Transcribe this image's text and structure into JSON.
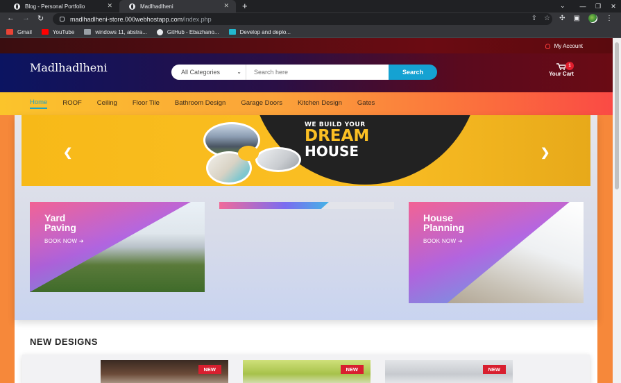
{
  "browser": {
    "tabs": [
      {
        "title": "Blog - Personal Portfolio",
        "active": false
      },
      {
        "title": "Madlhadlheni",
        "active": true
      }
    ],
    "url_host": "madlhadlheni-store.000webhostapp.com",
    "url_path": "/index.php",
    "bookmarks": [
      {
        "label": "Gmail",
        "color": "#ea4335"
      },
      {
        "label": "YouTube",
        "color": "#ff0000"
      },
      {
        "label": "windows 11, abstra...",
        "color": "#9aa0a6"
      },
      {
        "label": "GitHub - Ebazhano...",
        "color": "#e8eaed"
      },
      {
        "label": "Develop and deplo...",
        "color": "#22b8cf"
      }
    ]
  },
  "site": {
    "account_label": "My Account",
    "logo": "Madlhadlheni",
    "search": {
      "category": "All Categories",
      "placeholder": "Search here",
      "button": "Search"
    },
    "cart": {
      "label": "Your Cart",
      "count": "1"
    },
    "nav": [
      "Home",
      "ROOF",
      "Ceiling",
      "Floor Tile",
      "Bathroom Design",
      "Garage Doors",
      "Kitchen Design",
      "Gates"
    ],
    "active_nav": "Home",
    "slider": {
      "line1": "WE BUILD YOUR",
      "line2": "DREAM",
      "line3": "HOUSE"
    },
    "cards": [
      {
        "title_line1": "Yard",
        "title_line2": "Paving",
        "cta": "BOOK NOW"
      },
      {
        "title_line1": "House",
        "title_line2": "Planning",
        "cta": "BOOK NOW"
      }
    ],
    "section_title": "NEW DESIGNS",
    "new_badge": "NEW",
    "colors": {
      "accent": "#15a2d2",
      "badge": "#d81f2f",
      "nav_active": "#1fa3c3"
    }
  }
}
